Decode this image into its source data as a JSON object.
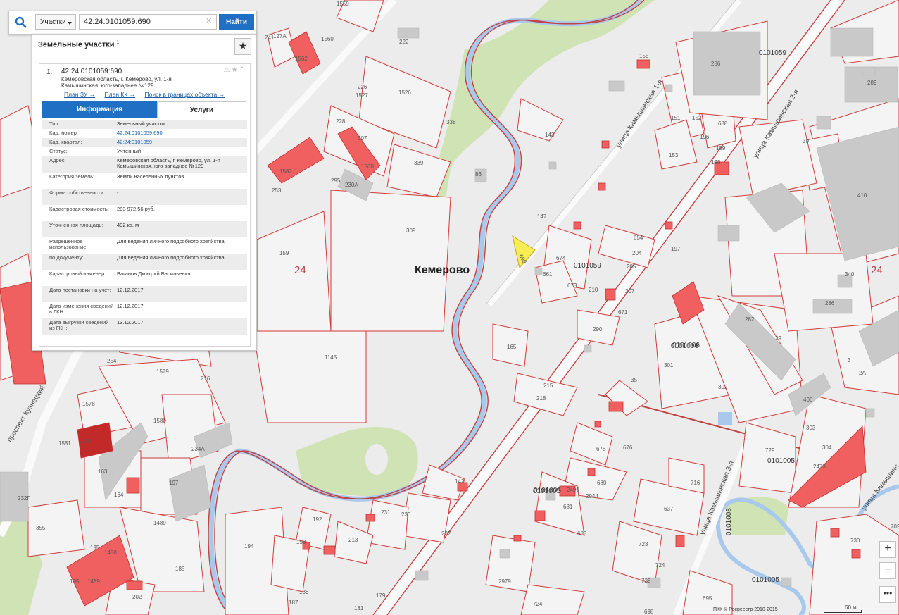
{
  "search": {
    "type_label": "Участки",
    "query": "42:24:0101059:690",
    "find_label": "Найти"
  },
  "panel": {
    "title": "Земельные участки",
    "title_sup": "1",
    "result": {
      "index": "1.",
      "cadastral_number": "42:24:0101059:690",
      "address": "Кемеровская область, г. Кемерово, ул. 1-я Камышинская, юго-западнее №129",
      "links": [
        "План ЗУ →",
        "План КК →",
        "Поиск в границах объекта →"
      ]
    },
    "tabs": [
      "Информация",
      "Услуги"
    ],
    "rows": [
      {
        "k": "Тип:",
        "v": "Земельный участок"
      },
      {
        "k": "Кад. номер:",
        "v": "42:24:0101059:690",
        "link": true
      },
      {
        "k": "Кад. квартал:",
        "v": "42:24:0101059",
        "link": true
      },
      {
        "k": "Статус:",
        "v": "Учтенный"
      },
      {
        "k": "Адрес:",
        "v": "Кемеровская область, г. Кемерово, ул. 1-я Камышинская, юго-западнее №129"
      },
      {
        "k": "Категория земель:",
        "v": "Земли населённых пунктов"
      },
      {
        "k": "Форма собственности:",
        "v": "-"
      },
      {
        "k": "Кадастровая стоимость:",
        "v": "283 972,56 руб."
      },
      {
        "k": "Уточненная площадь:",
        "v": "492 кв. м"
      },
      {
        "k": "Разрешенное использование:",
        "v": "Для ведения личного подсобного хозяйства"
      },
      {
        "k": "по документу:",
        "v": "Для ведения личного подсобного хозяйства"
      },
      {
        "k": "Кадастровый инженер:",
        "v": "Ваганов Дмитрий Васильевич"
      },
      {
        "k": "Дата постановки на учет:",
        "v": "12.12.2017"
      },
      {
        "k": "Дата изменения сведений в ГКН:",
        "v": "12.12.2017"
      },
      {
        "k": "Дата выгрузки сведений из ГКН:",
        "v": "13.12.2017"
      }
    ]
  },
  "map": {
    "city": "Кемерово",
    "selected_parcel": "690",
    "streets": [
      "улица Камышинская 1-я",
      "улица Камышинская 2-я",
      "улица Камышинская 3-я",
      "проспект Кузнецкий",
      "улица Камышинс"
    ],
    "quarters": [
      "0101059",
      "0101006",
      "0101005",
      "0101005",
      "0101008",
      "0101005"
    ],
    "big_labels": [
      "24",
      "24"
    ],
    "parcel_labels": [
      "1559",
      "127А",
      "241",
      "1560",
      "1562",
      "222",
      "286",
      "0101059",
      "155",
      "226",
      "1527",
      "1526",
      "228",
      "307",
      "338",
      "230А",
      "295",
      "253",
      "1582",
      "339",
      "86",
      "1560",
      "289",
      "151",
      "152",
      "688",
      "196",
      "189",
      "153",
      "198",
      "143",
      "39",
      "410",
      "147",
      "654",
      "204",
      "197",
      "674",
      "205",
      "207",
      "673",
      "210",
      "661",
      "671",
      "309",
      "159",
      "340",
      "286",
      "290",
      "282",
      "29",
      "0101006",
      "301",
      "3",
      "2А",
      "302",
      "165",
      "215",
      "218",
      "1145",
      "35",
      "406",
      "303",
      "304",
      "2473",
      "1579",
      "216",
      "254",
      "1578",
      "1580",
      "1581",
      "1524",
      "234А",
      "163",
      "164",
      "197",
      "1489",
      "232Г",
      "355",
      "192",
      "194",
      "193",
      "213",
      "231",
      "230",
      "227",
      "195",
      "1480",
      "185",
      "195",
      "1489",
      "202",
      "188",
      "187",
      "181",
      "179",
      "142",
      "678",
      "676",
      "680",
      "0101005",
      "2944",
      "2499",
      "681",
      "683",
      "716",
      "729",
      "637",
      "723",
      "724",
      "739",
      "695",
      "2979",
      "724",
      "698",
      "702",
      "730"
    ],
    "copyright": "ПКК © Росреестр 2010-2015",
    "scale": "60 м"
  },
  "colors": {
    "accent": "#1f6fc4",
    "parcel_border": "#d23a3a",
    "parcel_fill": "#f4f4f4",
    "building": "#c9c9c9",
    "highlight_parcel": "#f06060",
    "river": "#a9c9ec",
    "green": "#cfe3b5",
    "selected": "#f6ee52"
  },
  "icons": {
    "search": "search-icon",
    "clear": "clear-icon",
    "star": "star-icon",
    "zoom_in": "zoom-in-icon",
    "zoom_out": "zoom-out-icon",
    "more": "more-icon"
  }
}
